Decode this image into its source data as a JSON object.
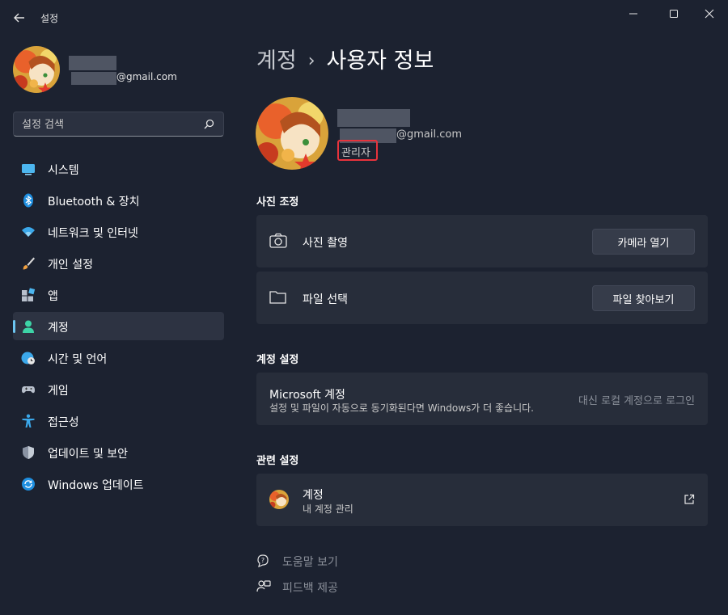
{
  "window": {
    "app_title": "설정"
  },
  "sidebar": {
    "account_email": "@gmail.com",
    "search_placeholder": "설정 검색",
    "items": [
      {
        "label": "시스템",
        "icon": "monitor-icon"
      },
      {
        "label": "Bluetooth & 장치",
        "icon": "bluetooth-icon"
      },
      {
        "label": "네트워크 및 인터넷",
        "icon": "wifi-icon"
      },
      {
        "label": "개인 설정",
        "icon": "brush-icon"
      },
      {
        "label": "앱",
        "icon": "apps-icon"
      },
      {
        "label": "계정",
        "icon": "person-icon",
        "active": true
      },
      {
        "label": "시간 및 언어",
        "icon": "globe-clock-icon"
      },
      {
        "label": "게임",
        "icon": "gamepad-icon"
      },
      {
        "label": "접근성",
        "icon": "accessibility-icon"
      },
      {
        "label": "업데이트 및 보안",
        "icon": "shield-icon"
      },
      {
        "label": "Windows 업데이트",
        "icon": "sync-icon"
      }
    ]
  },
  "main": {
    "breadcrumb": {
      "parent": "계정",
      "separator": "›",
      "current": "사용자 정보"
    },
    "profile": {
      "email": "@gmail.com",
      "role": "관리자"
    },
    "photo_section": {
      "title": "사진 조정",
      "camera": {
        "label": "사진 촬영",
        "button": "카메라 열기"
      },
      "file": {
        "label": "파일 선택",
        "button": "파일 찾아보기"
      }
    },
    "account_section": {
      "title": "계정 설정",
      "microsoft": {
        "title": "Microsoft 계정",
        "description": "설정 및 파일이 자동으로 동기화된다면 Windows가 더 좋습니다.",
        "link": "대신 로컬 계정으로 로그인"
      }
    },
    "related_section": {
      "title": "관련 설정",
      "account": {
        "title": "계정",
        "subtitle": "내 계정 관리"
      }
    },
    "footer": {
      "help": "도움말 보기",
      "feedback": "피드백 제공"
    }
  },
  "colors": {
    "accent": "#6cc6f2",
    "background": "#1c2230",
    "card": "#272d3a",
    "highlight": "#e8333c"
  }
}
